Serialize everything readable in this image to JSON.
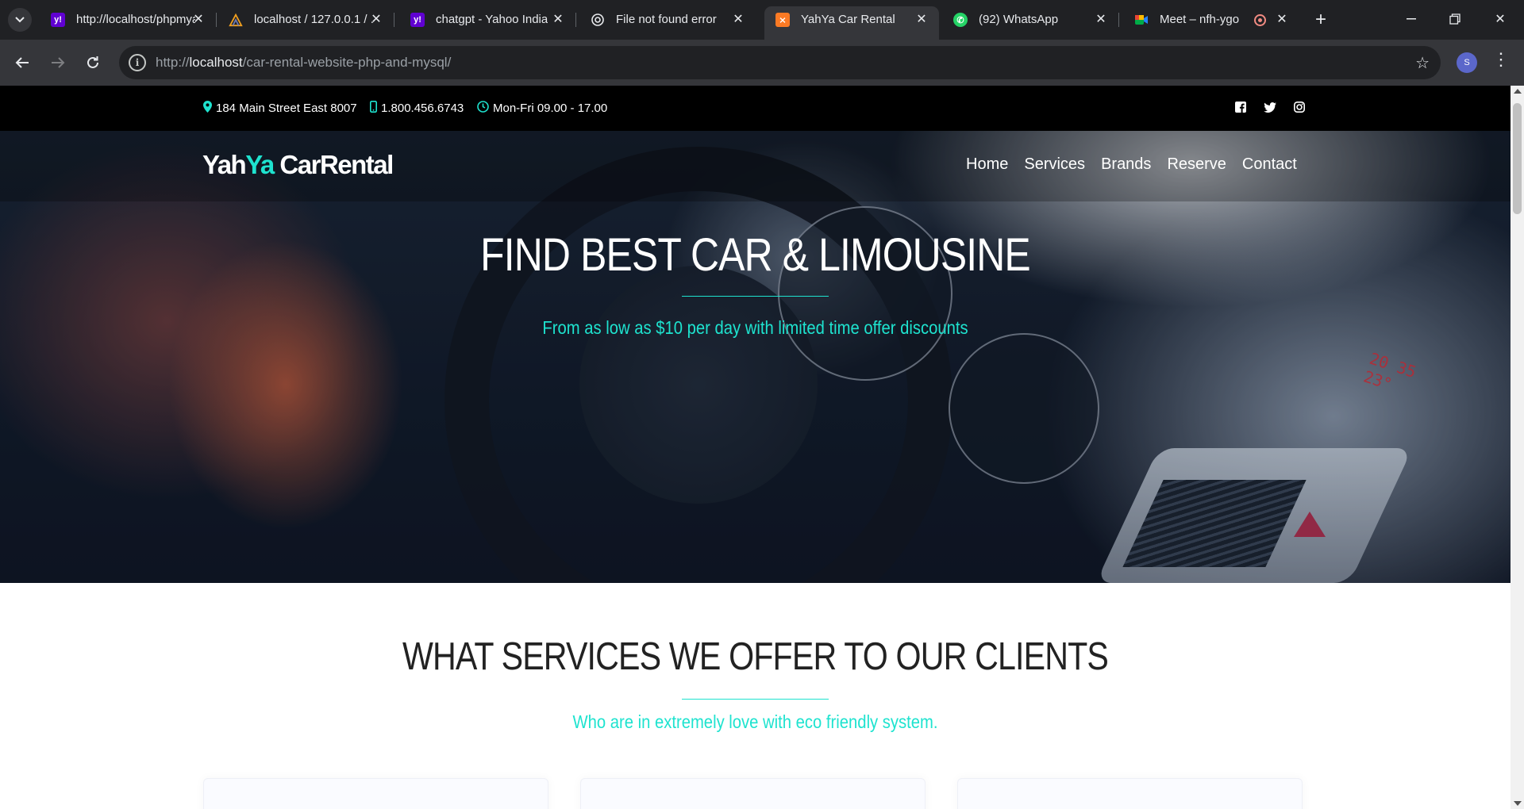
{
  "browser": {
    "tabs": [
      {
        "title": "http://localhost/phpmyadmin",
        "favicon": "yahoo-icon",
        "color": "#6001d2"
      },
      {
        "title": "localhost / 127.0.0.1 / ...",
        "favicon": "phpmyadmin-icon",
        "color": "#f0a020"
      },
      {
        "title": "chatgpt - Yahoo India",
        "favicon": "yahoo-icon",
        "color": "#6001d2"
      },
      {
        "title": "File not found error",
        "favicon": "openai-icon",
        "color": "#e8eaed"
      },
      {
        "title": "YahYa Car Rental",
        "favicon": "xampp-icon",
        "color": "#fb7a24"
      },
      {
        "title": "(92) WhatsApp",
        "favicon": "whatsapp-icon",
        "color": "#25d366"
      },
      {
        "title": "Meet – nfh-ygok",
        "favicon": "meet-icon",
        "color": "#00ac47"
      }
    ],
    "url_host": "localhost",
    "url_prefix": "http://",
    "url_path": "/car-rental-website-php-and-mysql/",
    "profile_initial": "S"
  },
  "topbar": {
    "address": "184 Main Street East 8007",
    "phone": "1.800.456.6743",
    "hours": "Mon-Fri 09.00 - 17.00"
  },
  "logo": {
    "part1": "Yah",
    "part2": "Ya",
    "part3": " CarRental"
  },
  "menu": [
    "Home",
    "Services",
    "Brands",
    "Reserve",
    "Contact"
  ],
  "hero": {
    "title": "FIND BEST CAR & LIMOUSINE",
    "subtitle": "From as low as $10 per day with limited time offer discounts",
    "dash_display_1": "20 35",
    "dash_display_2": "23°"
  },
  "services": {
    "title": "WHAT SERVICES WE OFFER TO OUR CLIENTS",
    "subtitle": "Who are in extremely love with eco friendly system."
  },
  "colors": {
    "accent": "#1ee3cf",
    "chrome_dark": "#202124",
    "chrome_mid": "#35363a"
  }
}
